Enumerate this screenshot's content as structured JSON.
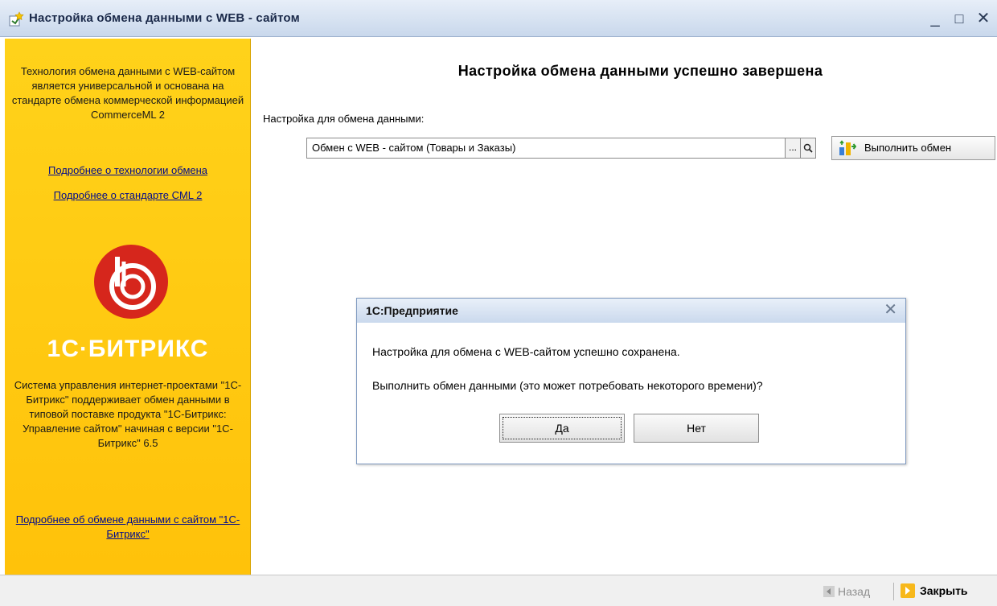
{
  "window": {
    "title": "Настройка обмена данными с WEB - сайтом",
    "minimize": "_",
    "maximize": "□",
    "close": "✕"
  },
  "sidebar": {
    "intro": "Технология обмена данными с WEB-сайтом является универсальной и основана на стандарте обмена коммерческой информацией CommerceML 2",
    "link_technology": "Подробнее о технологии обмена",
    "link_cml": "Подробнее о стандарте CML 2",
    "brand": "1С·БИТРИКС",
    "description": "Система управления интернет-проектами \"1С-Битрикс\" поддерживает обмен данными в типовой поставке продукта \"1С-Битрикс: Управление сайтом\" начиная с версии \"1С-Битрикс\" 6.5",
    "link_bitrix": "Подробнее об обмене данными с сайтом \"1С-Битрикс\"",
    "colors": {
      "background": "#ffc20a",
      "logo": "#d6261c",
      "brand_text": "#ffffff"
    }
  },
  "main": {
    "heading": "Настройка обмена данными успешно завершена",
    "field_label": "Настройка для обмена данными:",
    "field_value": "Обмен с WEB - сайтом (Товары и Заказы)",
    "select_button": "...",
    "execute_button": "Выполнить обмен"
  },
  "dialog": {
    "title": "1С:Предприятие",
    "message1": "Настройка для обмена с WEB-сайтом успешно сохранена.",
    "message2": "Выполнить обмен данными (это может потребовать некоторого времени)?",
    "yes": "Да",
    "no": "Нет",
    "close": "✕"
  },
  "footer": {
    "back": "Назад",
    "close": "Закрыть"
  }
}
